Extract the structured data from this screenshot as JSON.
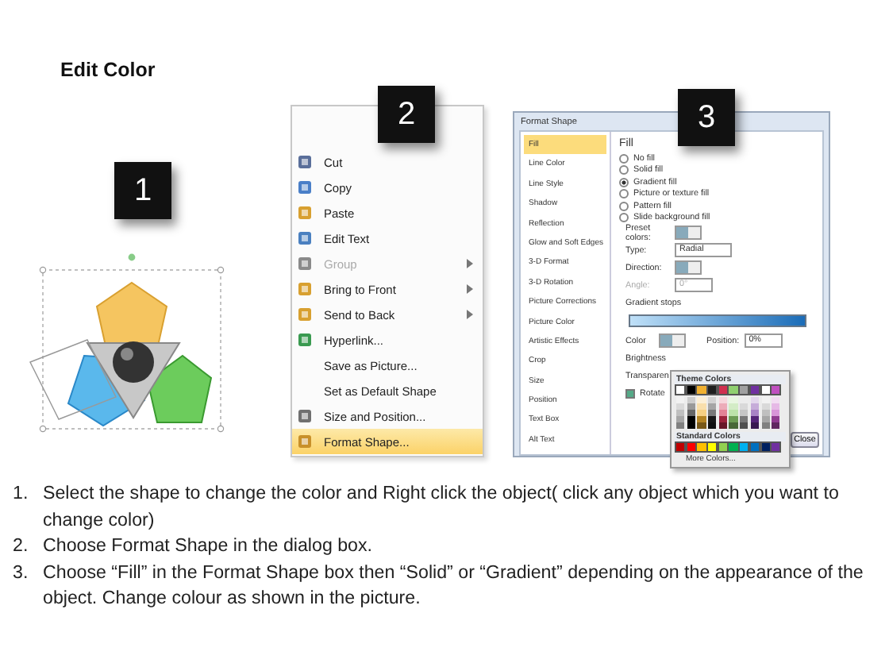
{
  "title": "Edit Color",
  "steps": [
    {
      "number": "1"
    },
    {
      "number": "2"
    },
    {
      "number": "3"
    }
  ],
  "context_menu": {
    "items": [
      {
        "label": "Cut",
        "disabled": false,
        "selected": false,
        "submenu": false
      },
      {
        "label": "Copy",
        "disabled": false,
        "selected": false,
        "submenu": false
      },
      {
        "label": "Paste",
        "disabled": false,
        "selected": false,
        "submenu": false
      },
      {
        "label": "Edit Text",
        "disabled": false,
        "selected": false,
        "submenu": false
      },
      {
        "label": "Group",
        "disabled": true,
        "selected": false,
        "submenu": true
      },
      {
        "label": "Bring to Front",
        "disabled": false,
        "selected": false,
        "submenu": true
      },
      {
        "label": "Send to Back",
        "disabled": false,
        "selected": false,
        "submenu": true
      },
      {
        "label": "Hyperlink...",
        "disabled": false,
        "selected": false,
        "submenu": false
      },
      {
        "label": "Save as Picture...",
        "disabled": false,
        "selected": false,
        "submenu": false
      },
      {
        "label": "Set as Default Shape",
        "disabled": false,
        "selected": false,
        "submenu": false
      },
      {
        "label": "Size and Position...",
        "disabled": false,
        "selected": false,
        "submenu": false
      },
      {
        "label": "Format Shape...",
        "disabled": false,
        "selected": true,
        "submenu": false
      }
    ]
  },
  "format_dialog": {
    "title": "Format Shape",
    "categories": [
      {
        "label": "Fill",
        "selected": true
      },
      {
        "label": "Line Color",
        "selected": false
      },
      {
        "label": "Line Style",
        "selected": false
      },
      {
        "label": "Shadow",
        "selected": false
      },
      {
        "label": "Reflection",
        "selected": false
      },
      {
        "label": "Glow and Soft Edges",
        "selected": false
      },
      {
        "label": "3-D Format",
        "selected": false
      },
      {
        "label": "3-D Rotation",
        "selected": false
      },
      {
        "label": "Picture Corrections",
        "selected": false
      },
      {
        "label": "Picture Color",
        "selected": false
      },
      {
        "label": "Artistic Effects",
        "selected": false
      },
      {
        "label": "Crop",
        "selected": false
      },
      {
        "label": "Size",
        "selected": false
      },
      {
        "label": "Position",
        "selected": false
      },
      {
        "label": "Text Box",
        "selected": false
      },
      {
        "label": "Alt Text",
        "selected": false
      }
    ],
    "heading": "Fill",
    "fill_options": [
      {
        "label": "No fill",
        "selected": false
      },
      {
        "label": "Solid fill",
        "selected": false
      },
      {
        "label": "Gradient fill",
        "selected": true
      },
      {
        "label": "Picture or texture fill",
        "selected": false
      },
      {
        "label": "Pattern fill",
        "selected": false
      },
      {
        "label": "Slide background fill",
        "selected": false
      }
    ],
    "preset_label": "Preset colors:",
    "type_label": "Type:",
    "type_value": "Radial",
    "direction_label": "Direction:",
    "angle_label": "Angle:",
    "angle_value": "0°",
    "gradient_stops_label": "Gradient stops",
    "color_label": "Color",
    "position_label": "Position:",
    "position_value": "0%",
    "brightness_label": "Brightness",
    "transparency_label": "Transparen",
    "rotate_label": "Rotate",
    "rotate_checked": true,
    "close_button": "Close"
  },
  "color_popup": {
    "theme_heading": "Theme Colors",
    "theme_colors": [
      {
        "color": "#ffffff"
      },
      {
        "color": "#000000"
      },
      {
        "color": "#f0b030"
      },
      {
        "color": "#1f1f1f"
      },
      {
        "color": "#d03050"
      },
      {
        "color": "#90d070"
      },
      {
        "color": "#a0a0a0"
      },
      {
        "color": "#7030a0"
      },
      {
        "color": "#ffffff"
      },
      {
        "color": "#c050c0"
      }
    ],
    "standard_heading": "Standard Colors",
    "standard_colors": [
      {
        "color": "#c00000"
      },
      {
        "color": "#ff0000"
      },
      {
        "color": "#ffc000"
      },
      {
        "color": "#ffff00"
      },
      {
        "color": "#92d050"
      },
      {
        "color": "#00b050"
      },
      {
        "color": "#00b0f0"
      },
      {
        "color": "#0070c0"
      },
      {
        "color": "#002060"
      },
      {
        "color": "#7030a0"
      }
    ],
    "more_colors": "More Colors..."
  },
  "instructions": [
    {
      "number": "1.",
      "text": "Select the shape to change the color and Right click the object( click any object which you want to change color)"
    },
    {
      "number": "2.",
      "text": "Choose Format Shape in the dialog box."
    },
    {
      "number": "3.",
      "text": "Choose “Fill” in the Format Shape box then “Solid” or “Gradient” depending on the appearance of the object. Change colour as shown in the picture."
    }
  ]
}
